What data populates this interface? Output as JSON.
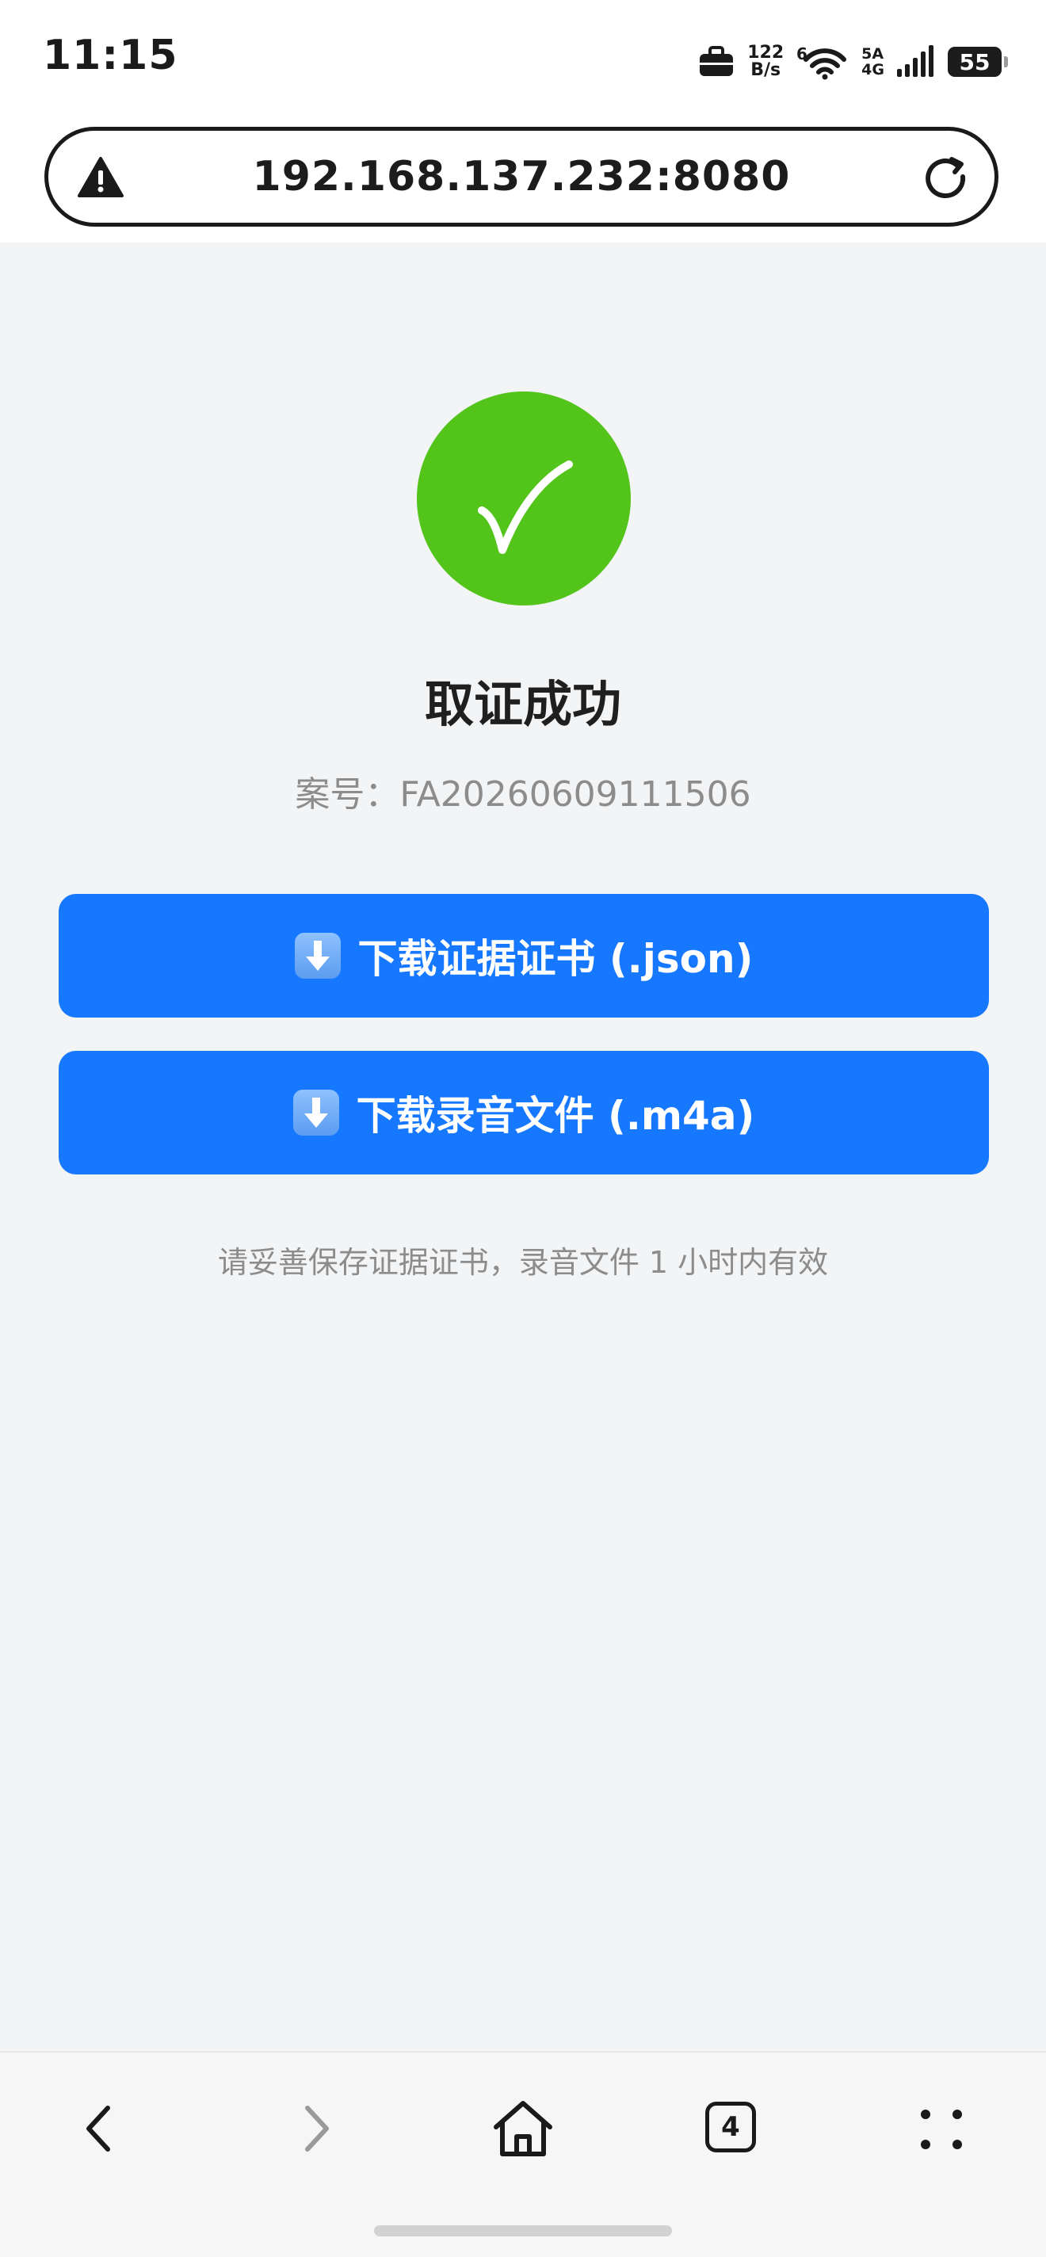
{
  "status_bar": {
    "time": "11:15",
    "speed_value": "122",
    "speed_unit": "B/s",
    "net_top": "5A",
    "net_bottom": "4G",
    "battery": "55"
  },
  "browser": {
    "url": "192.168.137.232:8080",
    "tab_count": "4"
  },
  "result": {
    "title": "取证成功",
    "case_number_label": "案号：",
    "case_number": "FA20260609111506",
    "download_certificate_label": "下载证据证书 (.json)",
    "download_recording_label": "下载录音文件 (.m4a)",
    "hint": "请妥善保存证据证书，录音文件 1 小时内有效"
  },
  "colors": {
    "success": "#52c41a",
    "primary": "#1677ff",
    "background": "#f3f4f6"
  },
  "icons": {
    "status": [
      "briefcase-icon",
      "wifi-icon",
      "signal-icon",
      "battery-icon"
    ],
    "urlbar": [
      "warning-icon",
      "reload-icon"
    ],
    "nav": [
      "back-arrow-icon",
      "forward-arrow-icon",
      "home-icon",
      "tabs-icon",
      "menu-dots-icon"
    ]
  }
}
